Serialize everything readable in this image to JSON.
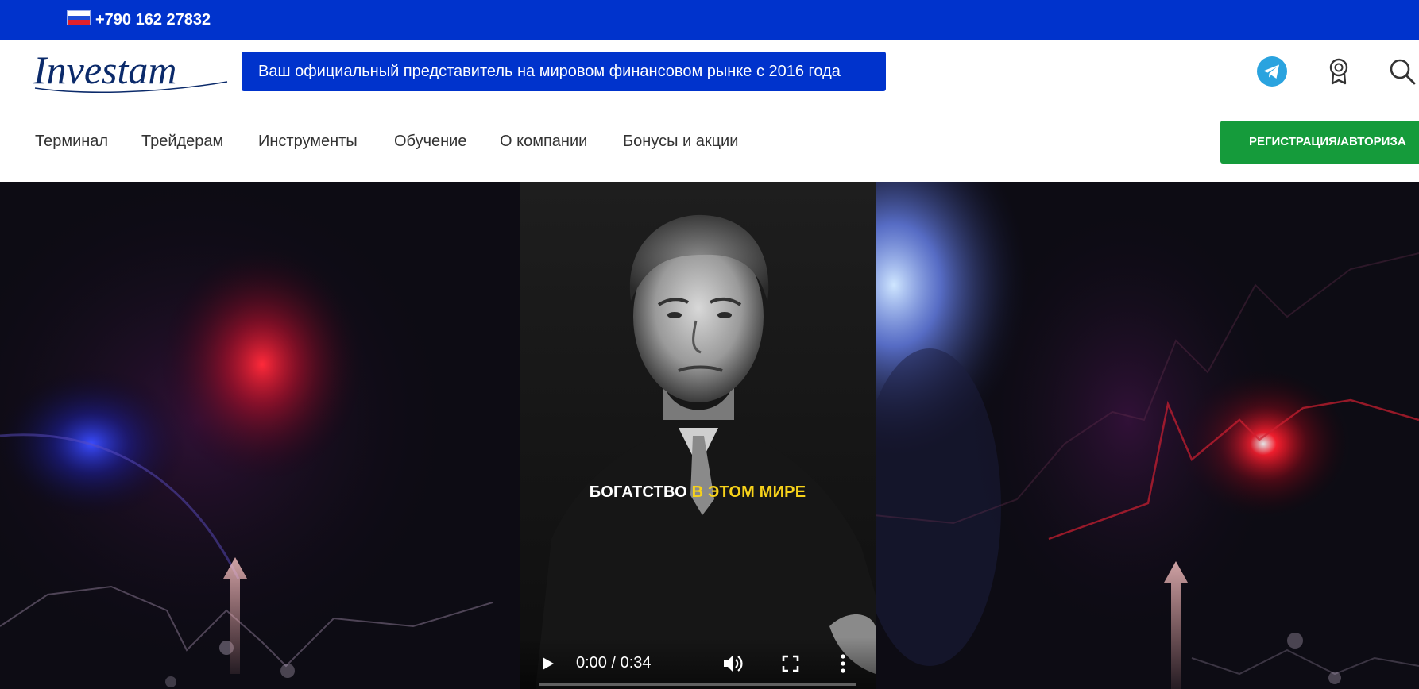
{
  "topbar": {
    "phone": "+790 162 27832",
    "flag_icon": "russia-flag-icon"
  },
  "header": {
    "logo_text": "Investam",
    "tagline": "Ваш официальный представитель на мировом финансовом рынке с 2016 года",
    "icons": [
      "telegram-icon",
      "award-icon",
      "search-icon"
    ],
    "telegram_color": "#2aa3df"
  },
  "nav": {
    "items": [
      "Терминал",
      "Трейдерам",
      "Инструменты",
      "Обучение",
      "О компании",
      "Бонусы и акции"
    ],
    "register_label": "РЕГИСТРАЦИЯ/АВТОРИЗА"
  },
  "video": {
    "caption_white": "БОГАТСТВО ",
    "caption_yellow": "В ЭТОМ МИРЕ",
    "time": "0:00 / 0:34",
    "progress": 0,
    "highlight_color": "#f7d21a"
  },
  "colors": {
    "brand_blue": "#0033cc",
    "register_green": "#159b3b",
    "logo_navy": "#0b2a6a"
  }
}
